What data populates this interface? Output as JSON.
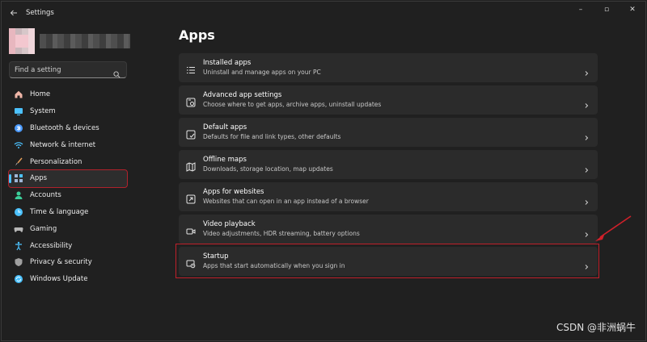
{
  "window": {
    "title": "Settings",
    "controls": {
      "minimize": "–",
      "maximize": "▫",
      "close": "✕"
    }
  },
  "sidebar": {
    "search": {
      "placeholder": "Find a setting"
    },
    "items": [
      {
        "label": "Home",
        "icon": "home-icon",
        "color": "#f0b6a8"
      },
      {
        "label": "System",
        "icon": "display-icon",
        "color": "#4cc2ff"
      },
      {
        "label": "Bluetooth & devices",
        "icon": "bluetooth-icon",
        "color": "#4c9bff"
      },
      {
        "label": "Network & internet",
        "icon": "wifi-icon",
        "color": "#4cc2ff"
      },
      {
        "label": "Personalization",
        "icon": "brush-icon",
        "color": "#e8a05a"
      },
      {
        "label": "Apps",
        "icon": "apps-icon",
        "color": "#9fb6d6",
        "active": true
      },
      {
        "label": "Accounts",
        "icon": "person-icon",
        "color": "#3ccf9a"
      },
      {
        "label": "Time & language",
        "icon": "globe-clock-icon",
        "color": "#4cc2ff"
      },
      {
        "label": "Gaming",
        "icon": "controller-icon",
        "color": "#b8b8b8"
      },
      {
        "label": "Accessibility",
        "icon": "accessibility-icon",
        "color": "#4cc2ff"
      },
      {
        "label": "Privacy & security",
        "icon": "shield-icon",
        "color": "#a0a0a0"
      },
      {
        "label": "Windows Update",
        "icon": "update-icon",
        "color": "#4cc2ff"
      }
    ]
  },
  "main": {
    "title": "Apps",
    "cards": [
      {
        "title": "Installed apps",
        "subtitle": "Uninstall and manage apps on your PC",
        "icon": "list-icon"
      },
      {
        "title": "Advanced app settings",
        "subtitle": "Choose where to get apps, archive apps, uninstall updates",
        "icon": "app-settings-icon"
      },
      {
        "title": "Default apps",
        "subtitle": "Defaults for file and link types, other defaults",
        "icon": "default-apps-icon"
      },
      {
        "title": "Offline maps",
        "subtitle": "Downloads, storage location, map updates",
        "icon": "map-icon"
      },
      {
        "title": "Apps for websites",
        "subtitle": "Websites that can open in an app instead of a browser",
        "icon": "open-in-app-icon"
      },
      {
        "title": "Video playback",
        "subtitle": "Video adjustments, HDR streaming, battery options",
        "icon": "video-icon"
      },
      {
        "title": "Startup",
        "subtitle": "Apps that start automatically when you sign in",
        "icon": "startup-icon"
      }
    ]
  },
  "annotation": {
    "highlight_color": "#c0202a"
  },
  "watermark": "CSDN @非洲蜗牛"
}
